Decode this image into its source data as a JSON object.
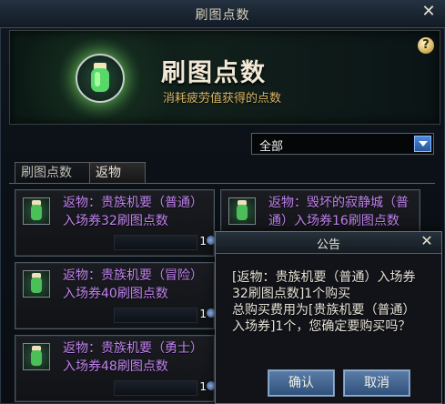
{
  "window": {
    "title": "刷图点数",
    "close_icon": "close-icon",
    "banner": {
      "title": "刷图点数",
      "subtitle": "消耗疲劳值获得的点数",
      "icon": "potion-bottle-icon",
      "help": "?"
    },
    "filter": {
      "selected": "全部"
    },
    "tabs": [
      {
        "label": "刷图点数",
        "active": false
      },
      {
        "label": "返物",
        "active": true
      }
    ],
    "cards": [
      {
        "text": "返物：贵族机要（普通）入场券32刷图点数",
        "count": "1"
      },
      {
        "text": "返物：毁坏的寂静城（普通）入场券16刷图点数",
        "count": ""
      },
      {
        "text": "返物：贵族机要（冒险）入场券40刷图点数",
        "count": "1"
      },
      {
        "text": "",
        "count": ""
      },
      {
        "text": "返物：贵族机要（勇士）入场券48刷图点数",
        "count": "1"
      },
      {
        "text": "",
        "count": ""
      }
    ]
  },
  "dialog": {
    "title": "公告",
    "close_icon": "close-icon",
    "message": "[返物：贵族机要（普通）入场券32刷图点数]1个购买\n总购买费用为[贵族机要（普通）入场券]1个，您确定要购买吗？",
    "buttons": {
      "confirm": "确认",
      "cancel": "取消"
    }
  }
}
